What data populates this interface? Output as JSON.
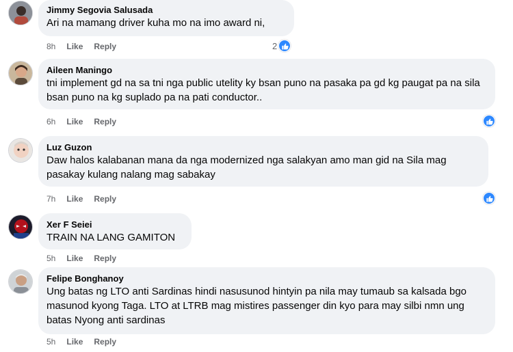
{
  "comments": [
    {
      "author": "Jimmy Segovia Salusada",
      "text": "Ari na mamang driver kuha mo na imo award ni,",
      "time": "8h",
      "like": "Like",
      "reply": "Reply",
      "reaction_count": "2",
      "avatar": "avatar-jimmy"
    },
    {
      "author": "Aileen Maningo",
      "text": "tni implement gd na sa tni nga public utelity ky bsan puno na pasaka pa gd kg paugat pa na sila bsan puno na kg suplado pa na pati conductor..",
      "time": "6h",
      "like": "Like",
      "reply": "Reply",
      "reaction_count": "",
      "avatar": "avatar-aileen"
    },
    {
      "author": "Luz Guzon",
      "text": "Daw halos kalabanan mana da nga modernized nga salakyan amo man gid na Sila mag pasakay kulang nalang mag sabakay",
      "time": "7h",
      "like": "Like",
      "reply": "Reply",
      "reaction_count": "",
      "avatar": "avatar-luz"
    },
    {
      "author": "Xer F Seiei",
      "text": "TRAIN NA LANG GAMITON",
      "time": "5h",
      "like": "Like",
      "reply": "Reply",
      "reaction_count": "",
      "avatar": "avatar-xer"
    },
    {
      "author": "Felipe Bonghanoy",
      "text": "Ung batas ng LTO anti Sardinas hindi nasusunod hintyin pa nila may tumaub sa kalsada bgo masunod kyong Taga. LTO at LTRB mag mistires passenger din kyo para may silbi nmn ung batas Nyong anti sardinas",
      "time": "5h",
      "like": "Like",
      "reply": "Reply",
      "reaction_count": "",
      "avatar": "avatar-felipe"
    }
  ],
  "colors": {
    "bubble": "#f0f2f5",
    "meta": "#65676b",
    "like_blue": "#2d88ff"
  },
  "icons": {
    "reaction": "like-thumb-icon"
  }
}
